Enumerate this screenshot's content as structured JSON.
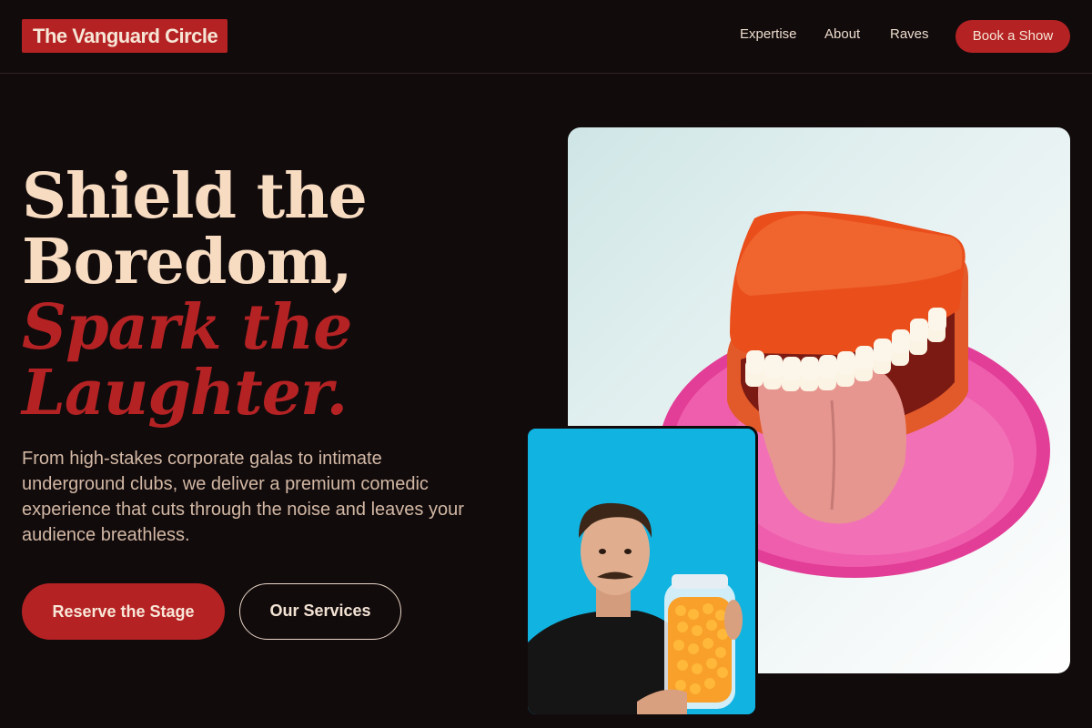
{
  "header": {
    "logo": "The Vanguard Circle",
    "nav": [
      "Expertise",
      "About",
      "Raves"
    ],
    "cta": "Book a Show"
  },
  "hero": {
    "headline_line1": "Shield the",
    "headline_line2": "Boredom,",
    "headline_line3": "Spark the",
    "headline_line4": "Laughter.",
    "subtext": "From high-stakes corporate galas to intimate underground clubs, we deliver a premium comedic experience that cuts through the noise and leaves your audience breathless.",
    "primary_button": "Reserve the Stage",
    "secondary_button": "Our Services"
  },
  "colors": {
    "background": "#120b0c",
    "accent": "#b52224",
    "cream": "#f7dcc2"
  },
  "images": {
    "main": "wind-up-chattering-teeth-photo",
    "inset": "man-with-candy-jar-photo"
  }
}
